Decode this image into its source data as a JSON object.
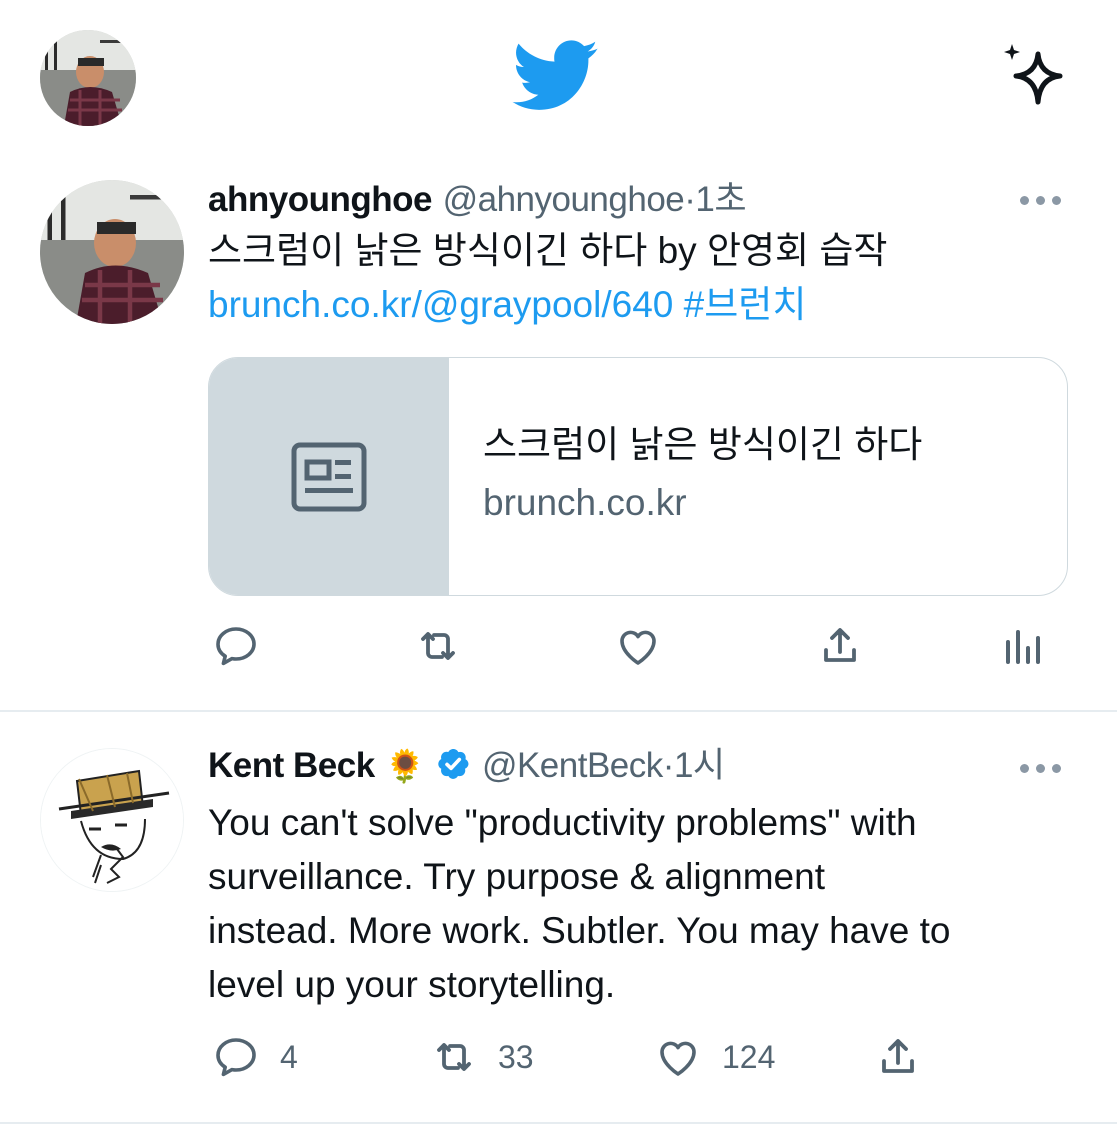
{
  "header": {
    "avatar_alt": "profile avatar",
    "logo": "twitter-bird-icon",
    "sparkle": "sparkle-icon"
  },
  "tweets": [
    {
      "name": "ahnyounghoe",
      "handle": "@ahnyounghoe",
      "separator": "·",
      "time": "1초",
      "text_line1": "스크럼이 낡은 방식이긴 하다 by 안영회 습작",
      "link_url": "brunch.co.kr/@graypool/640",
      "hashtag": "#브런치",
      "card": {
        "title": "스크럼이 낡은 방식이긴 하다",
        "domain": "brunch.co.kr",
        "thumb_icon": "article-icon"
      },
      "actions": {
        "reply": "",
        "retweet": "",
        "like": "",
        "share": "",
        "analytics": ""
      }
    },
    {
      "name": "Kent Beck",
      "emoji": "🌻",
      "verified_icon": "verified-badge-icon",
      "handle": "@KentBeck",
      "separator": "·",
      "time": "1시",
      "text_lines": [
        "You can't solve \"productivity problems\" with",
        "surveillance. Try purpose & alignment",
        "instead. More work. Subtler. You may have to",
        "level up your storytelling."
      ],
      "actions": {
        "reply": "4",
        "retweet": "33",
        "like": "124",
        "share": ""
      }
    }
  ],
  "colors": {
    "brand": "#1d9bf0",
    "text": "#0f1419",
    "muted": "#536471",
    "border": "#cfd9de"
  }
}
